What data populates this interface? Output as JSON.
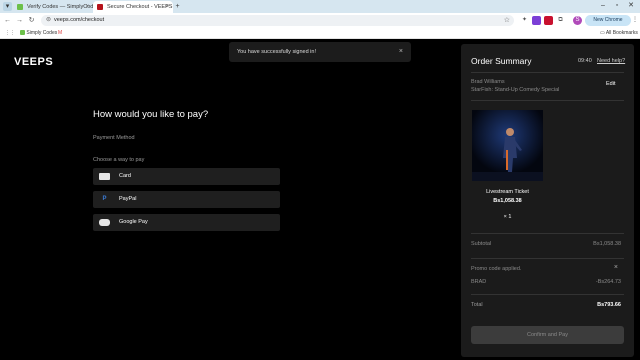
{
  "browser": {
    "tabs": [
      {
        "title": "Verify Codes — SimplyCodes",
        "active": false
      },
      {
        "title": "Secure Checkout - VEEPS",
        "active": true
      }
    ],
    "new_tab_glyph": "+",
    "url": "veeps.com/checkout",
    "new_chrome_label": "New Chrome available",
    "profile_initial": "S",
    "bookmarks": [
      {
        "label": "Simply Codes"
      }
    ],
    "all_bookmarks_label": "All Bookmarks"
  },
  "site": {
    "logo": "VEEPS"
  },
  "toast": {
    "message": "You have successfully signed in!",
    "close_glyph": "×"
  },
  "payment": {
    "title": "How would you like to pay?",
    "method_label": "Payment Method",
    "choose_label": "Choose a way to pay",
    "options": [
      {
        "label": "Card",
        "icon": "credit-card-icon"
      },
      {
        "label": "PayPal",
        "icon": "paypal-icon"
      },
      {
        "label": "Google Pay",
        "icon": "google-pay-icon"
      }
    ]
  },
  "summary": {
    "title": "Order Summary",
    "timer": "09:40",
    "help_label": "Need help?",
    "buyer_name": "Brad Williams",
    "show_name": "StarFish: Stand-Up Comedy Special",
    "edit_label": "Edit",
    "ticket_type": "Livestream Ticket",
    "ticket_price": "Bs1,058.38",
    "quantity": "× 1",
    "subtotal_label": "Subtotal",
    "subtotal_value": "Bs1,058.38",
    "promo_label": "Promo code applied.",
    "promo_code": "BRAD",
    "promo_discount": "-Bs264.73",
    "total_label": "Total",
    "total_value": "Bs793.66",
    "confirm_label": "Confirm and Pay"
  },
  "colors": {
    "page_bg": "#000000",
    "panel_bg": "#1b1b1b",
    "option_bg": "#1f1f1f",
    "text_primary": "#ffffff",
    "text_muted": "#8a8a8a"
  }
}
